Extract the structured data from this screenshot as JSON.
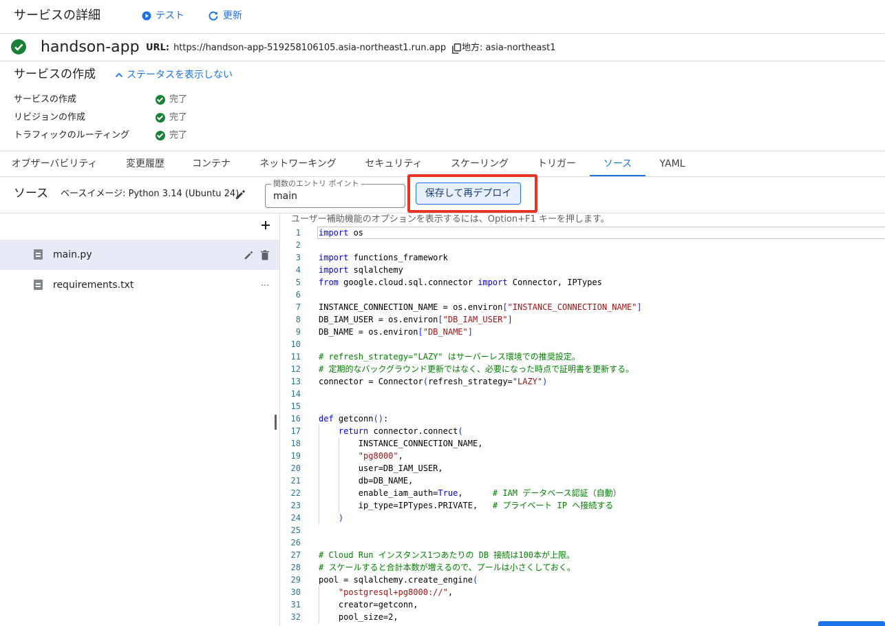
{
  "header": {
    "title": "サービスの詳細",
    "test_label": "テスト",
    "refresh_label": "更新"
  },
  "service": {
    "name": "handson-app",
    "url_label": "URL:",
    "url": "https://handson-app-519258106105.asia-northeast1.run.app",
    "region_label": "地方:",
    "region": "asia-northeast1"
  },
  "status": {
    "title": "サービスの作成",
    "toggle_label": "ステータスを表示しない",
    "rows": [
      {
        "label": "サービスの作成",
        "value": "完了"
      },
      {
        "label": "リビジョンの作成",
        "value": "完了"
      },
      {
        "label": "トラフィックのルーティング",
        "value": "完了"
      }
    ]
  },
  "tabs": [
    {
      "label": "オブザーバビリティ"
    },
    {
      "label": "変更履歴"
    },
    {
      "label": "コンテナ"
    },
    {
      "label": "ネットワーキング"
    },
    {
      "label": "セキュリティ"
    },
    {
      "label": "スケーリング"
    },
    {
      "label": "トリガー"
    },
    {
      "label": "ソース"
    },
    {
      "label": "YAML"
    }
  ],
  "active_tab": "ソース",
  "source": {
    "title": "ソース",
    "base_image": "ベースイメージ: Python 3.14 (Ubuntu 24)",
    "entry_label": "関数のエントリ ポイント",
    "entry_value": "main",
    "redeploy_label": "保存して再デプロイ"
  },
  "files": [
    {
      "name": "main.py",
      "selected": true
    },
    {
      "name": "requirements.txt",
      "selected": false
    }
  ],
  "editor": {
    "a11y_hint": "ユーザー補助機能のオプションを表示するには、Option+F1 キーを押します。",
    "lines": [
      "import os",
      "",
      "import functions_framework",
      "import sqlalchemy",
      "from google.cloud.sql.connector import Connector, IPTypes",
      "",
      "INSTANCE_CONNECTION_NAME = os.environ[\"INSTANCE_CONNECTION_NAME\"]",
      "DB_IAM_USER = os.environ[\"DB_IAM_USER\"]",
      "DB_NAME = os.environ[\"DB_NAME\"]",
      "",
      "# refresh_strategy=\"LAZY\" はサーバーレス環境での推奨設定。",
      "# 定期的なバックグラウンド更新ではなく、必要になった時点で証明書を更新する。",
      "connector = Connector(refresh_strategy=\"LAZY\")",
      "",
      "",
      "def getconn():",
      "    return connector.connect(",
      "        INSTANCE_CONNECTION_NAME,",
      "        \"pg8000\",",
      "        user=DB_IAM_USER,",
      "        db=DB_NAME,",
      "        enable_iam_auth=True,      # IAM データベース認証（自動）",
      "        ip_type=IPTypes.PRIVATE,   # プライベート IP へ接続する",
      "    )",
      "",
      "",
      "# Cloud Run インスタンス1つあたりの DB 接続は100本が上限。",
      "# スケールすると合計本数が増えるので、プールは小さくしておく。",
      "pool = sqlalchemy.create_engine(",
      "    \"postgresql+pg8000://\",",
      "    creator=getconn,",
      "    pool_size=2,"
    ]
  },
  "colors": {
    "accent": "#1a73e8",
    "success": "#188038",
    "highlight": "#ea3323"
  }
}
